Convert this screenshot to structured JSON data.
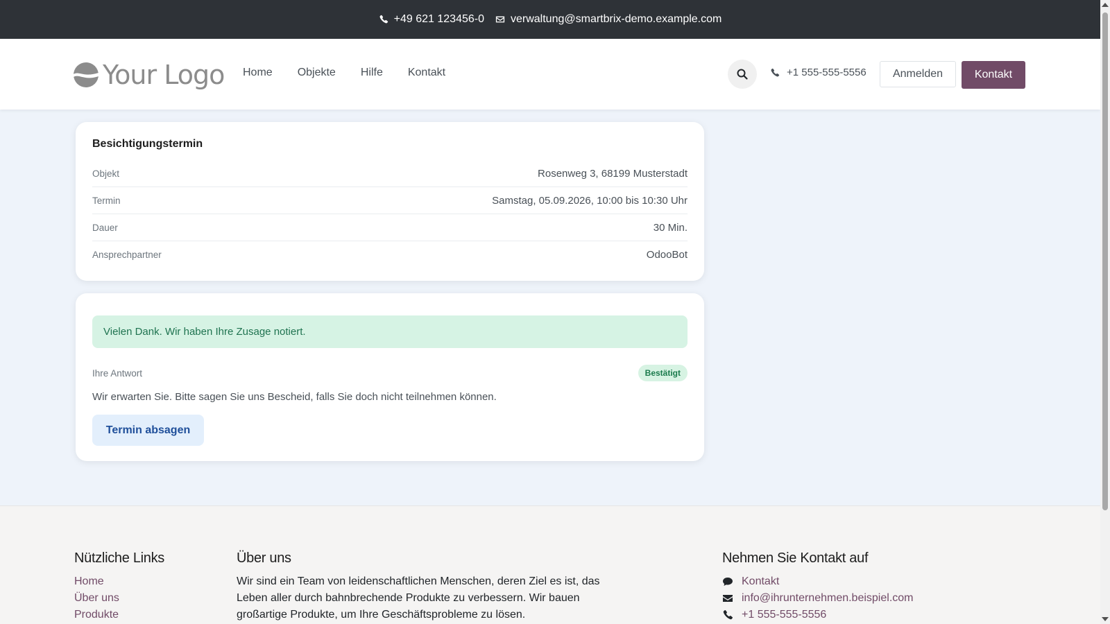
{
  "topbar": {
    "phone": "+49 621 123456-0",
    "email": "verwaltung@smartbrix-demo.example.com"
  },
  "header": {
    "logo_text": "Your Logo",
    "nav": [
      "Home",
      "Objekte",
      "Hilfe",
      "Kontakt"
    ],
    "phone": "+1 555-555-5556",
    "login_label": "Anmelden",
    "contact_label": "Kontakt"
  },
  "appointment": {
    "title": "Besichtigungstermin",
    "rows": [
      {
        "label": "Objekt",
        "value": "Rosenweg 3, 68199 Musterstadt"
      },
      {
        "label": "Termin",
        "value": "Samstag, 05.09.2026, 10:00 bis 10:30 Uhr"
      },
      {
        "label": "Dauer",
        "value": "30 Min."
      },
      {
        "label": "Ansprechpartner",
        "value": "OdooBot"
      }
    ]
  },
  "response": {
    "alert": "Vielen Dank. Wir haben Ihre Zusage notiert.",
    "answer_label": "Ihre Antwort",
    "status_badge": "Bestätigt",
    "text": "Wir erwarten Sie. Bitte sagen Sie uns Bescheid, falls Sie doch nicht teilnehmen können.",
    "cancel_label": "Termin absagen"
  },
  "footer": {
    "links_title": "Nützliche Links",
    "links": [
      "Home",
      "Über uns",
      "Produkte"
    ],
    "about_title": "Über uns",
    "about_text": "Wir sind ein Team von leidenschaftlichen Menschen, deren Ziel es ist, das Leben aller durch bahnbrechende Produkte zu verbessern. Wir bauen großartige Produkte, um Ihre Geschäftsprobleme zu lösen.",
    "contact_title": "Nehmen Sie Kontakt auf",
    "contact_items": [
      {
        "icon": "comment-icon",
        "text": "Kontakt"
      },
      {
        "icon": "envelope-icon",
        "text": "info@ihrunternehmen.beispiel.com"
      },
      {
        "icon": "phone-icon",
        "text": "+1 555-555-5556"
      }
    ]
  },
  "colors": {
    "brand": "#714b67",
    "topbar": "#2e3237",
    "success": "#1f7350",
    "page_bg": "#eef3fa"
  }
}
